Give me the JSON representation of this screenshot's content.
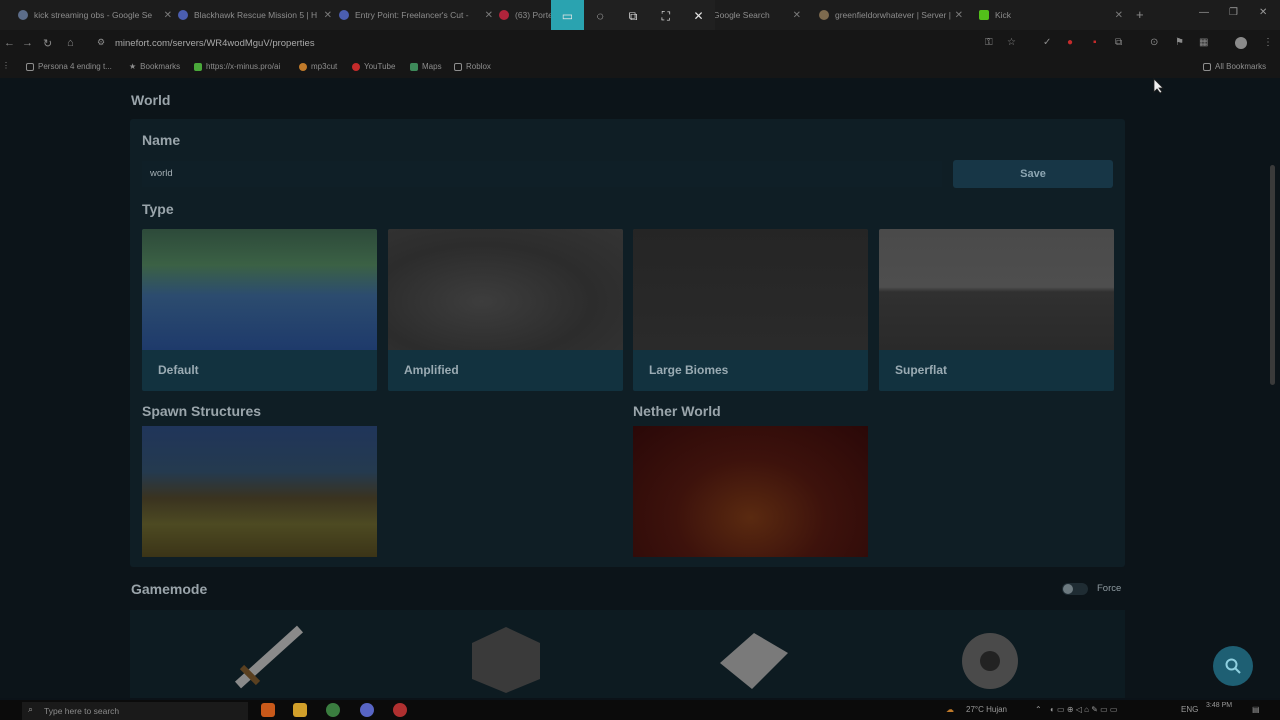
{
  "browser": {
    "tabs": [
      {
        "title": "kick streaming obs - Google Se",
        "color": "#5c6d8a"
      },
      {
        "title": "Blackhawk Rescue Mission 5 | H",
        "color": "#4b5eb0"
      },
      {
        "title": "Entry Point: Freelancer's Cut - ",
        "color": "#4b5eb0"
      },
      {
        "title": "(63) Porte",
        "color": "#b0243b"
      },
      {
        "title": "Google Search",
        "color": "#5c6d8a"
      },
      {
        "title": "greenfieldorwhatever | Server | ",
        "color": "#7d6a4e"
      },
      {
        "title": "Kick",
        "color": "#53c01a"
      }
    ],
    "url": "minefort.com/servers/WR4wodMguV/properties",
    "bookmarks": [
      {
        "label": "Persona 4 ending t...",
        "color": "#8e8e8e"
      },
      {
        "label": "Bookmarks",
        "color": "#8e8e8e"
      },
      {
        "label": "https://x-minus.pro/ai",
        "color": "#4aa83a"
      },
      {
        "label": "mp3cut",
        "color": "#c07a2a"
      },
      {
        "label": "YouTube",
        "color": "#c52b2b"
      },
      {
        "label": "Maps",
        "color": "#3e8a5a"
      },
      {
        "label": "Roblox",
        "color": "#8e8e8e"
      }
    ],
    "all_bookmarks": "All Bookmarks"
  },
  "page": {
    "world_title": "World",
    "name_label": "Name",
    "name_value": "world",
    "save_label": "Save",
    "type_label": "Type",
    "types": [
      "Default",
      "Amplified",
      "Large Biomes",
      "Superflat"
    ],
    "spawn_label": "Spawn Structures",
    "nether_label": "Nether World",
    "gamemode_title": "Gamemode",
    "force_label": "Force"
  },
  "taskbar": {
    "search_placeholder": "Type here to search",
    "weather": "27°C  Hujan",
    "lang": "ENG",
    "time": "3:48 PM"
  },
  "colors": {
    "accent": "#2aa3b0",
    "panel": "#0f1e25",
    "save_button": "#173646"
  }
}
